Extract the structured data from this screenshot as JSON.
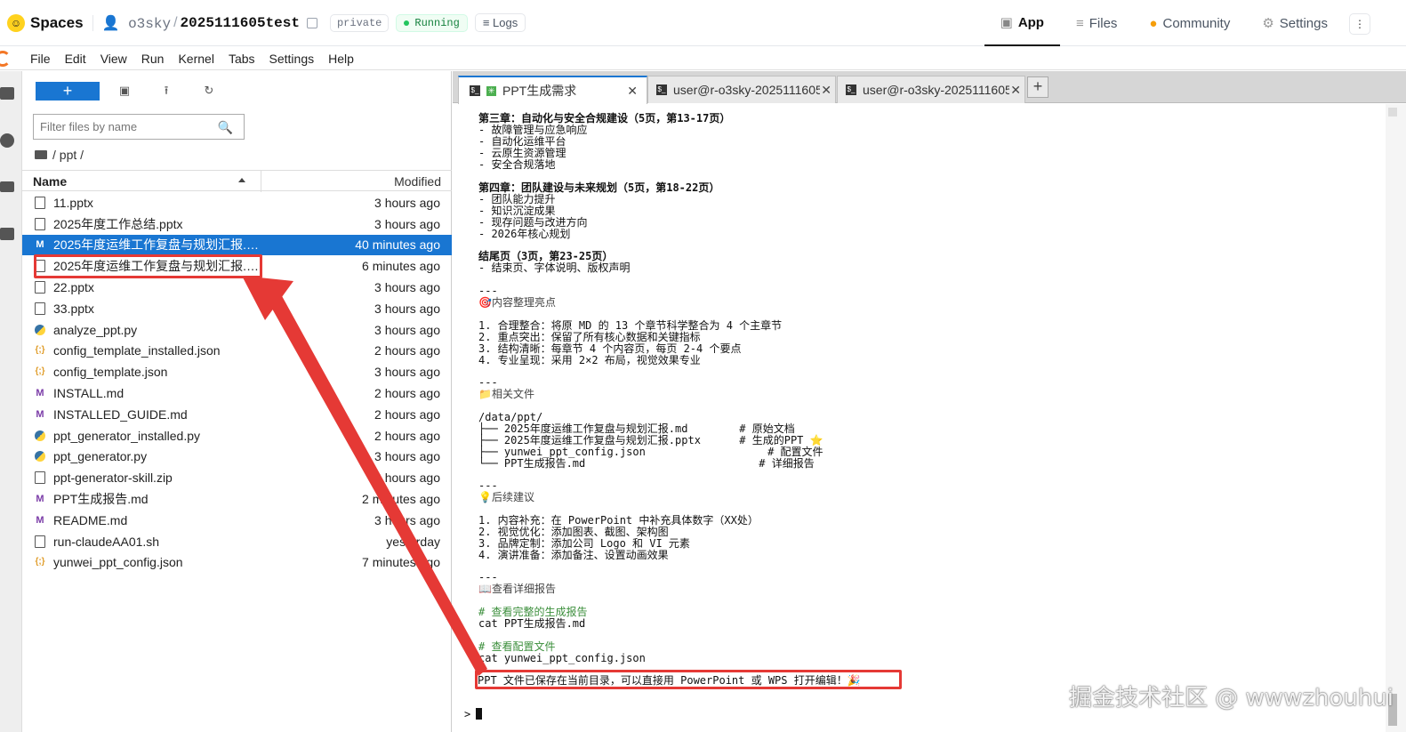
{
  "hf": {
    "spaces": "Spaces",
    "user": "o3sky",
    "repo": "2025111605test",
    "private": "private",
    "running": "Running",
    "logs": "Logs",
    "nav": [
      "App",
      "Files",
      "Community",
      "Settings"
    ],
    "menu_dots": "⋮"
  },
  "jupyter": {
    "menus": [
      "File",
      "Edit",
      "View",
      "Run",
      "Kernel",
      "Tabs",
      "Settings",
      "Help"
    ]
  },
  "filebrowser": {
    "new_label": "+",
    "filter_placeholder": "Filter files by name",
    "breadcrumb": "/ ppt /",
    "col_name": "Name",
    "col_modified": "Modified",
    "files": [
      {
        "name": "11.pptx",
        "modified": "3 hours ago",
        "icon": "doc"
      },
      {
        "name": "2025年度工作总结.pptx",
        "modified": "3 hours ago",
        "icon": "doc"
      },
      {
        "name": "2025年度运维工作复盘与规划汇报.md",
        "modified": "40 minutes ago",
        "icon": "md"
      },
      {
        "name": "2025年度运维工作复盘与规划汇报.pp...",
        "modified": "6 minutes ago",
        "icon": "doc"
      },
      {
        "name": "22.pptx",
        "modified": "3 hours ago",
        "icon": "doc"
      },
      {
        "name": "33.pptx",
        "modified": "3 hours ago",
        "icon": "doc"
      },
      {
        "name": "analyze_ppt.py",
        "modified": "3 hours ago",
        "icon": "py"
      },
      {
        "name": "config_template_installed.json",
        "modified": "2 hours ago",
        "icon": "json"
      },
      {
        "name": "config_template.json",
        "modified": "3 hours ago",
        "icon": "json"
      },
      {
        "name": "INSTALL.md",
        "modified": "2 hours ago",
        "icon": "md"
      },
      {
        "name": "INSTALLED_GUIDE.md",
        "modified": "2 hours ago",
        "icon": "md"
      },
      {
        "name": "ppt_generator_installed.py",
        "modified": "2 hours ago",
        "icon": "py"
      },
      {
        "name": "ppt_generator.py",
        "modified": "3 hours ago",
        "icon": "py"
      },
      {
        "name": "ppt-generator-skill.zip",
        "modified": "2 hours ago",
        "icon": "doc"
      },
      {
        "name": "PPT生成报告.md",
        "modified": "2 minutes ago",
        "icon": "md"
      },
      {
        "name": "README.md",
        "modified": "3 hours ago",
        "icon": "md"
      },
      {
        "name": "run-claudeAA01.sh",
        "modified": "yesterday",
        "icon": "doc"
      },
      {
        "name": "yunwei_ppt_config.json",
        "modified": "7 minutes ago",
        "icon": "json"
      }
    ]
  },
  "tabs": [
    {
      "label": "PPT生成需求"
    },
    {
      "label": "user@r-o3sky-2025111605"
    },
    {
      "label": "user@r-o3sky-2025111605"
    }
  ],
  "terminal": {
    "lines": [
      "第三章：自动化与安全合规建设（5页，第13-17页）",
      "- 故障管理与应急响应",
      "- 自动化运维平台",
      "- 云原生资源管理",
      "- 安全合规落地",
      "第四章：团队建设与未来规划（5页，第18-22页）",
      "- 团队能力提升",
      "- 知识沉淀成果",
      "- 现存问题与改进方向",
      "- 2026年核心规划",
      "结尾页（3页，第23-25页）",
      "- 结束页、字体说明、版权声明",
      "---",
      "🎯内容整理亮点",
      "1. 合理整合：将原 MD 的 13 个章节科学整合为 4 个主章节",
      "2. 重点突出：保留了所有核心数据和关键指标",
      "3. 结构清晰：每章节 4 个内容页，每页 2-4 个要点",
      "4. 专业呈现：采用 2×2 布局，视觉效果专业",
      "---",
      "📁相关文件",
      "/data/ppt/",
      "├── 2025年度运维工作复盘与规划汇报.md        # 原始文档",
      "├── 2025年度运维工作复盘与规划汇报.pptx      # 生成的PPT ⭐",
      "├── yunwei_ppt_config.json                   # 配置文件",
      "└── PPT生成报告.md                           # 详细报告",
      "---",
      "💡后续建议",
      "1. 内容补充：在 PowerPoint 中补充具体数字（XX处）",
      "2. 视觉优化：添加图表、截图、架构图",
      "3. 品牌定制：添加公司 Logo 和 VI 元素",
      "4. 演讲准备：添加备注、设置动画效果",
      "---",
      "📖查看详细报告",
      "# 查看完整的生成报告",
      "cat PPT生成报告.md",
      "# 查看配置文件",
      "cat yunwei_ppt_config.json",
      "PPT 文件已保存在当前目录，可以直接用 PowerPoint 或 WPS 打开编辑！🎉",
      ">"
    ]
  },
  "watermark": "掘金技术社区 @ wwwzhouhui",
  "colors": {
    "accent": "#1976d2",
    "highlight": "#e53935",
    "running": "#15803d"
  }
}
